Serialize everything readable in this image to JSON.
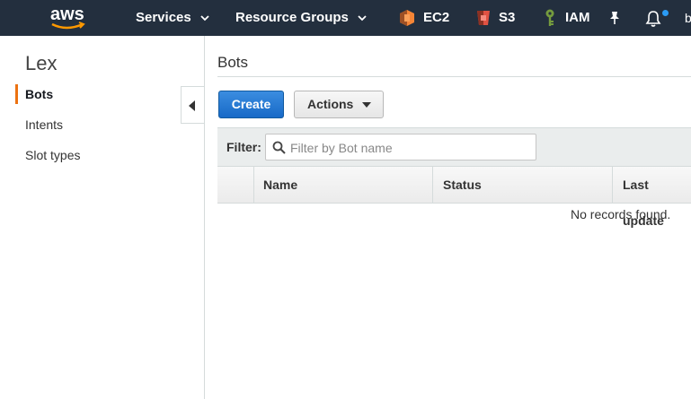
{
  "nav": {
    "logo_text": "aws",
    "services_label": "Services",
    "resource_groups_label": "Resource Groups",
    "shortcuts": [
      {
        "label": "EC2",
        "icon": "ec2-icon",
        "color": "#f58536"
      },
      {
        "label": "S3",
        "icon": "s3-icon",
        "color": "#e05243"
      },
      {
        "label": "IAM",
        "icon": "iam-icon",
        "color": "#759c3e"
      }
    ],
    "pin_icon": "pin-icon",
    "bell_icon": "bell-icon",
    "user_label": "b"
  },
  "sidebar": {
    "title": "Lex",
    "items": [
      {
        "label": "Bots",
        "active": true
      },
      {
        "label": "Intents",
        "active": false
      },
      {
        "label": "Slot types",
        "active": false
      }
    ]
  },
  "main": {
    "title": "Bots",
    "create_label": "Create",
    "actions_label": "Actions",
    "filter": {
      "label": "Filter:",
      "placeholder": "Filter by Bot name",
      "value": ""
    },
    "table": {
      "columns": [
        "Name",
        "Status",
        "Last update"
      ],
      "rows": [],
      "empty_text": "No records found."
    }
  },
  "colors": {
    "nav_bg": "#232f3e",
    "accent": "#ec7211",
    "primary_button": "#1769c7"
  }
}
